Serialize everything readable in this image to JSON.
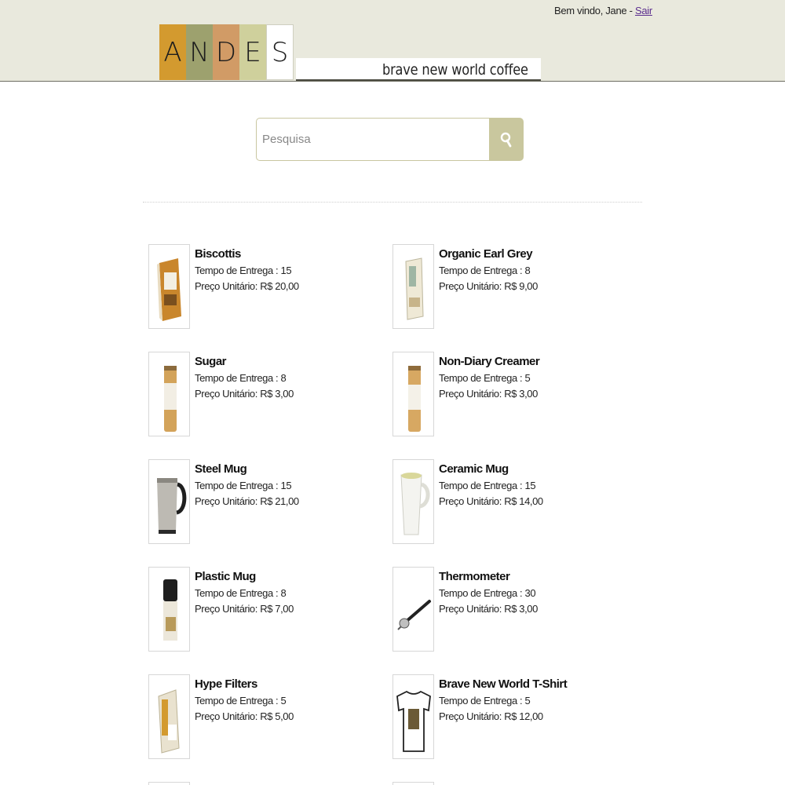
{
  "header": {
    "welcome_text": "Bem vindo, Jane - ",
    "logout_label": "Sair",
    "logo_letters": [
      "A",
      "N",
      "D",
      "E",
      "S"
    ],
    "logo_colors": [
      "#d39a2f",
      "#9da16e",
      "#d19b66",
      "#cfd09c",
      "#ffffff"
    ],
    "tagline": "brave new world coffee"
  },
  "search": {
    "placeholder": "Pesquisa",
    "button_icon": "search-icon",
    "button_color": "#c9c79e"
  },
  "labels": {
    "delivery_prefix": "Tempo de Entrega : ",
    "price_prefix": "Preço Unitário: "
  },
  "products": [
    {
      "name": "Biscottis",
      "delivery_time": "15",
      "unit_price": "R$ 20,00",
      "image_icon": "biscotti-box-icon"
    },
    {
      "name": "Organic Earl Grey",
      "delivery_time": "8",
      "unit_price": "R$ 9,00",
      "image_icon": "tea-box-icon"
    },
    {
      "name": "Sugar",
      "delivery_time": "8",
      "unit_price": "R$ 3,00",
      "image_icon": "sugar-canister-icon"
    },
    {
      "name": "Non-Diary Creamer",
      "delivery_time": "5",
      "unit_price": "R$ 3,00",
      "image_icon": "creamer-canister-icon"
    },
    {
      "name": "Steel Mug",
      "delivery_time": "15",
      "unit_price": "R$ 21,00",
      "image_icon": "steel-mug-icon"
    },
    {
      "name": "Ceramic Mug",
      "delivery_time": "15",
      "unit_price": "R$ 14,00",
      "image_icon": "ceramic-mug-icon"
    },
    {
      "name": "Plastic Mug",
      "delivery_time": "8",
      "unit_price": "R$ 7,00",
      "image_icon": "plastic-mug-icon"
    },
    {
      "name": "Thermometer",
      "delivery_time": "30",
      "unit_price": "R$ 3,00",
      "image_icon": "thermometer-icon"
    },
    {
      "name": "Hype Filters",
      "delivery_time": "5",
      "unit_price": "R$ 5,00",
      "image_icon": "filters-box-icon"
    },
    {
      "name": "Brave New World T-Shirt",
      "delivery_time": "5",
      "unit_price": "R$ 12,00",
      "image_icon": "tshirt-icon"
    }
  ]
}
